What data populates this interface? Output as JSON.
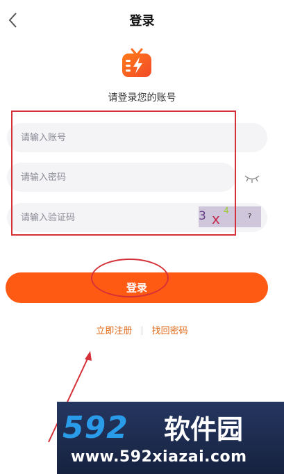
{
  "header": {
    "title": "登录",
    "back_icon": "chevron-left-icon"
  },
  "logo": {
    "icon": "tv-lightning-icon",
    "color_start": "#ff7a18",
    "color_end": "#f24a2a"
  },
  "subtitle": "请登录您的账号",
  "form": {
    "account_placeholder": "请输入账号",
    "account_value": "",
    "password_placeholder": "请输入密码",
    "password_value": "",
    "password_toggle_icon": "eye-closed-icon",
    "captcha_placeholder": "请输入验证码",
    "captcha_value": "",
    "captcha_chars": [
      "3",
      "x",
      "4",
      "?"
    ]
  },
  "login_button": {
    "label": "登录",
    "color": "#ff5a14"
  },
  "links": {
    "register": "立即注册",
    "separator": "|",
    "recover": "找回密码",
    "color": "#e06a1a"
  },
  "annotation_color": "#d53037",
  "watermark": {
    "brand_number": "592",
    "brand_name": "软件园",
    "url": "www.592xiazai.com"
  }
}
